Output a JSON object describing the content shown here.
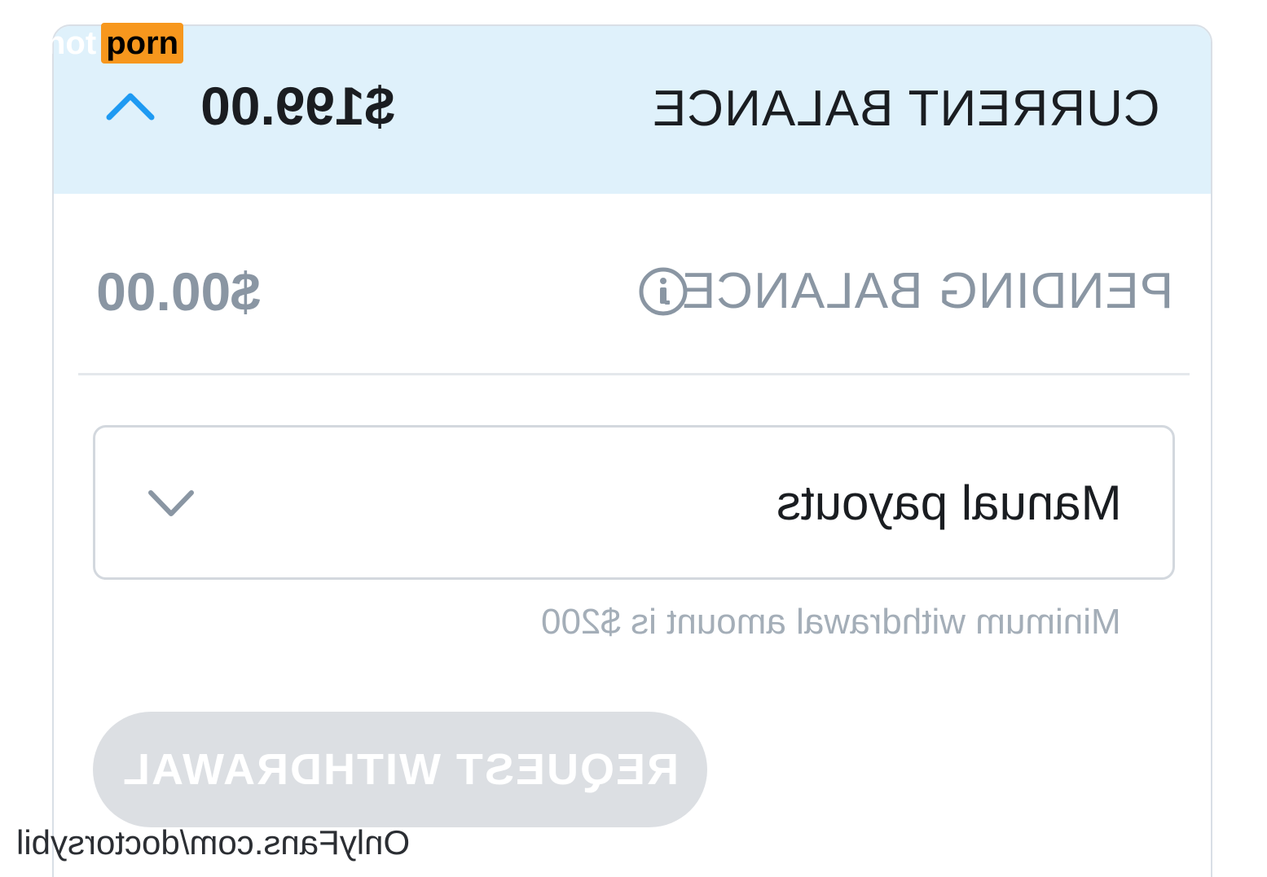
{
  "balance": {
    "current_label": "CURRENT BALANCE",
    "current_amount": "$199.00",
    "pending_label": "PENDING BALANCE",
    "pending_amount": "$00.00"
  },
  "payout": {
    "selected": "Manual payouts",
    "hint": "Minimum withdrawal amount is $200"
  },
  "actions": {
    "request_withdrawal": "REQUEST WITHDRAWAL",
    "request_withdrawal_enabled": false
  },
  "watermark": {
    "logo_hot": "hot",
    "logo_porn": "porn",
    "url": "OnlyFans.com/doctorsybil"
  },
  "icons": {
    "collapse": "chevron-up-icon",
    "info": "info-icon",
    "dropdown": "chevron-down-icon"
  },
  "colors": {
    "accent": "#1e9af2",
    "current_row_bg": "#dff1fb",
    "muted_text": "#8a96a3",
    "disabled_button": "#dcdfe3"
  }
}
